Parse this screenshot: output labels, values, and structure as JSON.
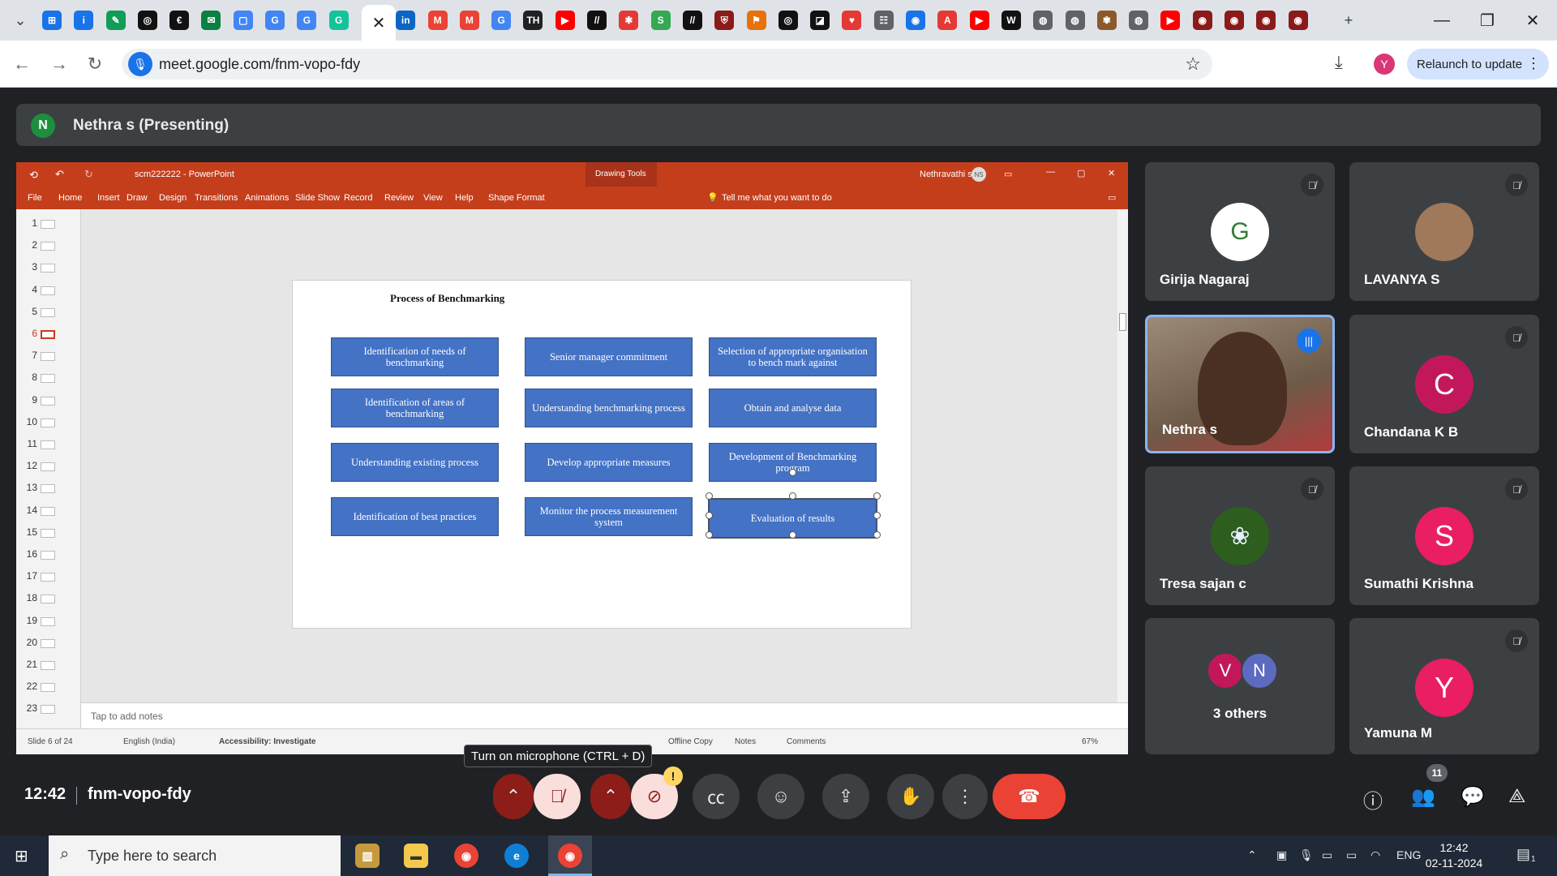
{
  "browser": {
    "url": "meet.google.com/fnm-vopo-fdy",
    "relaunch_label": "Relaunch to update",
    "profile_initial": "Y",
    "active_tab_close": "✕",
    "tab_favicons": [
      {
        "icon": "google-sites",
        "color": "#1a73e8",
        "glyph": "⊞"
      },
      {
        "icon": "info",
        "color": "#1a73e8",
        "glyph": "i"
      },
      {
        "icon": "edge-pen",
        "color": "#0f9d58",
        "glyph": "✎"
      },
      {
        "icon": "openai",
        "color": "#111111",
        "glyph": "◎"
      },
      {
        "icon": "course",
        "color": "#111111",
        "glyph": "€"
      },
      {
        "icon": "webmail",
        "color": "#0b8043",
        "glyph": "✉"
      },
      {
        "icon": "frame",
        "color": "#4285f4",
        "glyph": "▢"
      },
      {
        "icon": "google",
        "color": "#4285f4",
        "glyph": "G"
      },
      {
        "icon": "google",
        "color": "#4285f4",
        "glyph": "G"
      },
      {
        "icon": "grammarly",
        "color": "#15c39a",
        "glyph": "G"
      },
      {
        "icon": "linkedin",
        "color": "#0a66c2",
        "glyph": "in"
      },
      {
        "icon": "gmail",
        "color": "#ea4335",
        "glyph": "M"
      },
      {
        "icon": "gmail",
        "color": "#ea4335",
        "glyph": "M"
      },
      {
        "icon": "google",
        "color": "#4285f4",
        "glyph": "G"
      },
      {
        "icon": "news",
        "color": "#202124",
        "glyph": "TH"
      },
      {
        "icon": "youtube",
        "color": "#ff0000",
        "glyph": "▶"
      },
      {
        "icon": "notes",
        "color": "#111111",
        "glyph": "//"
      },
      {
        "icon": "asterisk",
        "color": "#e53935",
        "glyph": "✱"
      },
      {
        "icon": "sheets",
        "color": "#34a853",
        "glyph": "S"
      },
      {
        "icon": "notes",
        "color": "#111111",
        "glyph": "//"
      },
      {
        "icon": "college",
        "color": "#8b1a1a",
        "glyph": "⛨"
      },
      {
        "icon": "flag",
        "color": "#e8710a",
        "glyph": "⚑"
      },
      {
        "icon": "openai",
        "color": "#111111",
        "glyph": "◎"
      },
      {
        "icon": "tool",
        "color": "#111111",
        "glyph": "◪"
      },
      {
        "icon": "heart",
        "color": "#e53935",
        "glyph": "♥"
      },
      {
        "icon": "calendar",
        "color": "#5f6368",
        "glyph": "☷"
      },
      {
        "icon": "compass",
        "color": "#1a73e8",
        "glyph": "◉"
      },
      {
        "icon": "acrobat",
        "color": "#e53935",
        "glyph": "A"
      },
      {
        "icon": "youtube",
        "color": "#ff0000",
        "glyph": "▶"
      },
      {
        "icon": "wordpress",
        "color": "#111111",
        "glyph": "W"
      },
      {
        "icon": "globe",
        "color": "#5f6368",
        "glyph": "◍"
      },
      {
        "icon": "globe",
        "color": "#5f6368",
        "glyph": "◍"
      },
      {
        "icon": "emblem",
        "color": "#8b5a2b",
        "glyph": "✾"
      },
      {
        "icon": "globe",
        "color": "#5f6368",
        "glyph": "◍"
      },
      {
        "icon": "youtube",
        "color": "#ff0000",
        "glyph": "▶"
      },
      {
        "icon": "record",
        "color": "#8b1a1a",
        "glyph": "◉"
      },
      {
        "icon": "record",
        "color": "#8b1a1a",
        "glyph": "◉"
      },
      {
        "icon": "record",
        "color": "#8b1a1a",
        "glyph": "◉"
      },
      {
        "icon": "record",
        "color": "#8b1a1a",
        "glyph": "◉"
      }
    ]
  },
  "meet": {
    "presenter_initial": "N",
    "presenter_label": "Nethra s (Presenting)",
    "clock": "12:42",
    "meeting_code": "fnm-vopo-fdy",
    "mic_tooltip": "Turn on microphone (CTRL + D)",
    "people_count": "11",
    "participants": [
      {
        "name": "Girija Nagaraj",
        "type": "photo",
        "glyph": "G",
        "bg": "#ffffff",
        "fg": "#2e7d32",
        "muted": true
      },
      {
        "name": "LAVANYA S",
        "type": "photo",
        "glyph": "",
        "bg": "#a0785a",
        "fg": "#ffffff",
        "muted": true
      },
      {
        "name": "Nethra s",
        "type": "video",
        "glyph": "",
        "bg": "#8a7a6a",
        "fg": "#ffffff",
        "muted": false
      },
      {
        "name": "Chandana K B",
        "type": "initial",
        "glyph": "C",
        "bg": "#c2185b",
        "fg": "#ffffff",
        "muted": true
      },
      {
        "name": "Tresa sajan c",
        "type": "photo",
        "glyph": "❀",
        "bg": "#2e5e1e",
        "fg": "#e8f0ff",
        "muted": true
      },
      {
        "name": "Sumathi Krishna",
        "type": "initial",
        "glyph": "S",
        "bg": "#e91e63",
        "fg": "#ffffff",
        "muted": true
      },
      {
        "name": "3 others",
        "type": "group",
        "glyph": "",
        "bg": "#3c4043",
        "fg": "#ffffff",
        "muted": false
      },
      {
        "name": "Yamuna M",
        "type": "initial",
        "glyph": "Y",
        "bg": "#e91e63",
        "fg": "#ffffff",
        "muted": true
      }
    ],
    "others_initials": [
      "V",
      "N"
    ]
  },
  "powerpoint": {
    "title": "scm222222 - PowerPoint",
    "drawing_tools": "Drawing Tools",
    "user": "Nethravathi s",
    "user_initials": "NS",
    "tabs": [
      "File",
      "Home",
      "Insert",
      "Draw",
      "Design",
      "Transitions",
      "Animations",
      "Slide Show",
      "Record",
      "Review",
      "View",
      "Help",
      "Shape Format"
    ],
    "tell_me": "Tell me what you want to do",
    "slide_numbers": [
      "1",
      "2",
      "3",
      "4",
      "5",
      "6",
      "7",
      "8",
      "9",
      "10",
      "11",
      "12",
      "13",
      "14",
      "15",
      "16",
      "17",
      "18",
      "19",
      "20",
      "21",
      "22",
      "23"
    ],
    "selected_slide": "6",
    "notes_placeholder": "Tap to add notes",
    "status": {
      "slide": "Slide 6 of 24",
      "language": "English (India)",
      "accessibility": "Accessibility: Investigate",
      "offline": "Offline Copy",
      "notes": "Notes",
      "comments": "Comments",
      "zoom": "67%"
    },
    "slide": {
      "title": "Process of Benchmarking",
      "boxes": [
        [
          "Identification of needs of benchmarking",
          "Senior manager commitment",
          "Selection of appropriate organisation to bench mark against"
        ],
        [
          "Identification of areas of benchmarking",
          "Understanding benchmarking process",
          "Obtain and analyse data"
        ],
        [
          "Understanding existing process",
          "Develop  appropriate measures",
          "Development of Benchmarking program"
        ],
        [
          "Identification of best practices",
          "Monitor the process measurement system",
          "Evaluation of results"
        ]
      ]
    }
  },
  "taskbar": {
    "search_placeholder": "Type here to search",
    "language": "ENG",
    "time": "12:42",
    "date": "02-11-2024",
    "notification_count": "1"
  }
}
